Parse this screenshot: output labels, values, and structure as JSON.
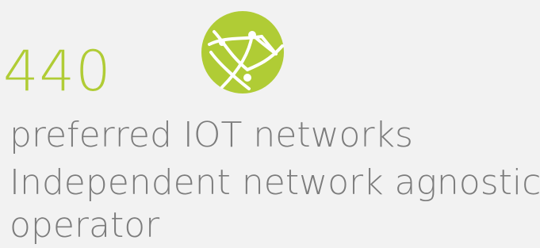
{
  "stat": {
    "value": "440",
    "label_line1": "preferred IOT networks",
    "label_line2": "Independent network agnostic",
    "label_line3": "operator"
  },
  "icon": {
    "name": "globe-network-icon",
    "color": "#b0cc35"
  },
  "colors": {
    "accent": "#b0cc35",
    "text": "#7c7c7c",
    "background": "#f2f2f2"
  }
}
